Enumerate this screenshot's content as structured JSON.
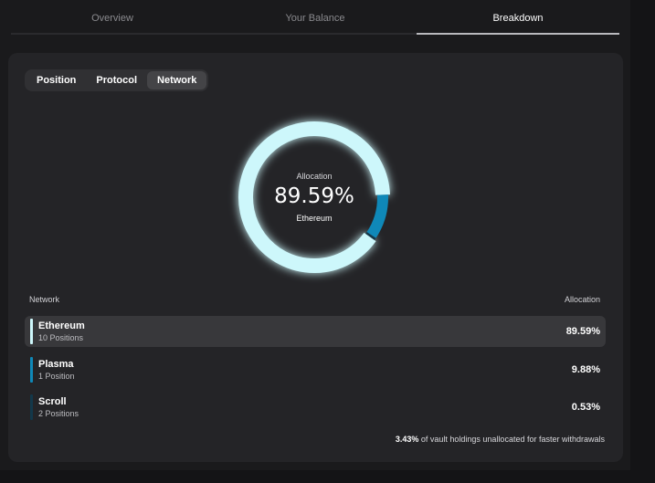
{
  "top_tabs": [
    {
      "label": "Overview"
    },
    {
      "label": "Your Balance"
    },
    {
      "label": "Breakdown"
    }
  ],
  "segments": [
    {
      "label": "Position"
    },
    {
      "label": "Protocol"
    },
    {
      "label": "Network"
    }
  ],
  "donut": {
    "label": "Allocation",
    "value": "89.59%",
    "network": "Ethereum"
  },
  "list": {
    "header_left": "Network",
    "header_right": "Allocation",
    "rows": [
      {
        "name": "Ethereum",
        "sub": "10 Positions",
        "pct": "89.59%",
        "color": "#cdf7fb",
        "share": 0.8959
      },
      {
        "name": "Plasma",
        "sub": "1 Position",
        "pct": "9.88%",
        "color": "#0f88b8",
        "share": 0.0988
      },
      {
        "name": "Scroll",
        "sub": "2 Positions",
        "pct": "0.53%",
        "color": "#13384a",
        "share": 0.0053
      }
    ]
  },
  "footnote": {
    "bold": "3.43%",
    "rest": " of vault holdings unallocated for faster withdrawals"
  },
  "colors": {
    "background": "#1a1a1c",
    "card": "#242427",
    "accent_light": "#cdf7fb",
    "accent_mid": "#0f88b8"
  }
}
